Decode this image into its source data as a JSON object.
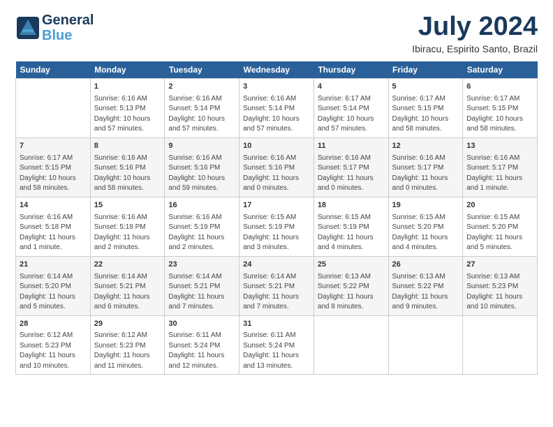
{
  "logo": {
    "general": "General",
    "blue": "Blue"
  },
  "header": {
    "month": "July 2024",
    "location": "Ibiracu, Espirito Santo, Brazil"
  },
  "weekdays": [
    "Sunday",
    "Monday",
    "Tuesday",
    "Wednesday",
    "Thursday",
    "Friday",
    "Saturday"
  ],
  "weeks": [
    [
      {
        "day": "",
        "info": ""
      },
      {
        "day": "1",
        "info": "Sunrise: 6:16 AM\nSunset: 5:13 PM\nDaylight: 10 hours\nand 57 minutes."
      },
      {
        "day": "2",
        "info": "Sunrise: 6:16 AM\nSunset: 5:14 PM\nDaylight: 10 hours\nand 57 minutes."
      },
      {
        "day": "3",
        "info": "Sunrise: 6:16 AM\nSunset: 5:14 PM\nDaylight: 10 hours\nand 57 minutes."
      },
      {
        "day": "4",
        "info": "Sunrise: 6:17 AM\nSunset: 5:14 PM\nDaylight: 10 hours\nand 57 minutes."
      },
      {
        "day": "5",
        "info": "Sunrise: 6:17 AM\nSunset: 5:15 PM\nDaylight: 10 hours\nand 58 minutes."
      },
      {
        "day": "6",
        "info": "Sunrise: 6:17 AM\nSunset: 5:15 PM\nDaylight: 10 hours\nand 58 minutes."
      }
    ],
    [
      {
        "day": "7",
        "info": "Sunrise: 6:17 AM\nSunset: 5:15 PM\nDaylight: 10 hours\nand 58 minutes."
      },
      {
        "day": "8",
        "info": "Sunrise: 6:16 AM\nSunset: 5:16 PM\nDaylight: 10 hours\nand 58 minutes."
      },
      {
        "day": "9",
        "info": "Sunrise: 6:16 AM\nSunset: 5:16 PM\nDaylight: 10 hours\nand 59 minutes."
      },
      {
        "day": "10",
        "info": "Sunrise: 6:16 AM\nSunset: 5:16 PM\nDaylight: 11 hours\nand 0 minutes."
      },
      {
        "day": "11",
        "info": "Sunrise: 6:16 AM\nSunset: 5:17 PM\nDaylight: 11 hours\nand 0 minutes."
      },
      {
        "day": "12",
        "info": "Sunrise: 6:16 AM\nSunset: 5:17 PM\nDaylight: 11 hours\nand 0 minutes."
      },
      {
        "day": "13",
        "info": "Sunrise: 6:16 AM\nSunset: 5:17 PM\nDaylight: 11 hours\nand 1 minute."
      }
    ],
    [
      {
        "day": "14",
        "info": "Sunrise: 6:16 AM\nSunset: 5:18 PM\nDaylight: 11 hours\nand 1 minute."
      },
      {
        "day": "15",
        "info": "Sunrise: 6:16 AM\nSunset: 5:18 PM\nDaylight: 11 hours\nand 2 minutes."
      },
      {
        "day": "16",
        "info": "Sunrise: 6:16 AM\nSunset: 5:19 PM\nDaylight: 11 hours\nand 2 minutes."
      },
      {
        "day": "17",
        "info": "Sunrise: 6:15 AM\nSunset: 5:19 PM\nDaylight: 11 hours\nand 3 minutes."
      },
      {
        "day": "18",
        "info": "Sunrise: 6:15 AM\nSunset: 5:19 PM\nDaylight: 11 hours\nand 4 minutes."
      },
      {
        "day": "19",
        "info": "Sunrise: 6:15 AM\nSunset: 5:20 PM\nDaylight: 11 hours\nand 4 minutes."
      },
      {
        "day": "20",
        "info": "Sunrise: 6:15 AM\nSunset: 5:20 PM\nDaylight: 11 hours\nand 5 minutes."
      }
    ],
    [
      {
        "day": "21",
        "info": "Sunrise: 6:14 AM\nSunset: 5:20 PM\nDaylight: 11 hours\nand 5 minutes."
      },
      {
        "day": "22",
        "info": "Sunrise: 6:14 AM\nSunset: 5:21 PM\nDaylight: 11 hours\nand 6 minutes."
      },
      {
        "day": "23",
        "info": "Sunrise: 6:14 AM\nSunset: 5:21 PM\nDaylight: 11 hours\nand 7 minutes."
      },
      {
        "day": "24",
        "info": "Sunrise: 6:14 AM\nSunset: 5:21 PM\nDaylight: 11 hours\nand 7 minutes."
      },
      {
        "day": "25",
        "info": "Sunrise: 6:13 AM\nSunset: 5:22 PM\nDaylight: 11 hours\nand 8 minutes."
      },
      {
        "day": "26",
        "info": "Sunrise: 6:13 AM\nSunset: 5:22 PM\nDaylight: 11 hours\nand 9 minutes."
      },
      {
        "day": "27",
        "info": "Sunrise: 6:13 AM\nSunset: 5:23 PM\nDaylight: 11 hours\nand 10 minutes."
      }
    ],
    [
      {
        "day": "28",
        "info": "Sunrise: 6:12 AM\nSunset: 5:23 PM\nDaylight: 11 hours\nand 10 minutes."
      },
      {
        "day": "29",
        "info": "Sunrise: 6:12 AM\nSunset: 5:23 PM\nDaylight: 11 hours\nand 11 minutes."
      },
      {
        "day": "30",
        "info": "Sunrise: 6:11 AM\nSunset: 5:24 PM\nDaylight: 11 hours\nand 12 minutes."
      },
      {
        "day": "31",
        "info": "Sunrise: 6:11 AM\nSunset: 5:24 PM\nDaylight: 11 hours\nand 13 minutes."
      },
      {
        "day": "",
        "info": ""
      },
      {
        "day": "",
        "info": ""
      },
      {
        "day": "",
        "info": ""
      }
    ]
  ]
}
